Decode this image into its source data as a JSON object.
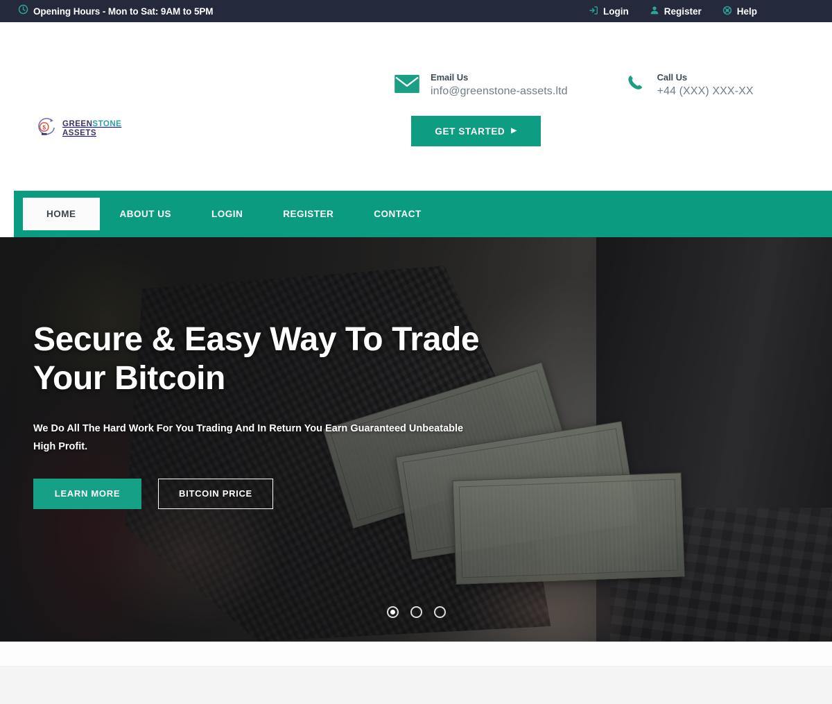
{
  "topbar": {
    "hours_icon": "clock-icon",
    "hours": "Opening Hours - Mon to Sat: 9AM to 5PM",
    "links": [
      {
        "label": "Login",
        "icon": "login-arrow-icon"
      },
      {
        "label": "Register",
        "icon": "user-icon"
      },
      {
        "label": "Help",
        "icon": "lifebuoy-icon"
      }
    ],
    "bg_color": "#25293c",
    "accent_color": "#2fa39a"
  },
  "header": {
    "logo": {
      "icon": "dollar-circle-icon",
      "line1_a": "GREEN",
      "line1_b": "STONE",
      "line2": "ASSETS",
      "color_dark": "#3a3560",
      "color_teal": "#2fa39a"
    },
    "contacts": [
      {
        "icon": "envelope-icon",
        "label": "Email Us",
        "value": "info@greenstone-assets.ltd"
      },
      {
        "icon": "phone-icon",
        "label": "Call Us",
        "value": "+44 (XXX) XXX-XX"
      }
    ],
    "get_started": {
      "label": "GET STARTED",
      "arrow": "▶",
      "color": "#0e9d82"
    }
  },
  "nav": {
    "bg_color": "#0b9b80",
    "items": [
      {
        "label": "HOME",
        "active": true
      },
      {
        "label": "ABOUT US",
        "active": false
      },
      {
        "label": "LOGIN",
        "active": false
      },
      {
        "label": "REGISTER",
        "active": false
      },
      {
        "label": "CONTACT",
        "active": false
      }
    ]
  },
  "hero": {
    "title": "Secure & Easy Way To Trade Your Bitcoin",
    "subtitle": "We Do All The Hard Work For You Trading And In Return You Earn Guaranteed Unbeatable High Profit.",
    "buttons": [
      {
        "label": "LEARN MORE",
        "style": "filled",
        "color": "#16a085"
      },
      {
        "label": "BITCOIN PRICE",
        "style": "outline",
        "color": "#ffffff"
      }
    ],
    "carousel": {
      "total": 3,
      "active_index": 0
    }
  }
}
